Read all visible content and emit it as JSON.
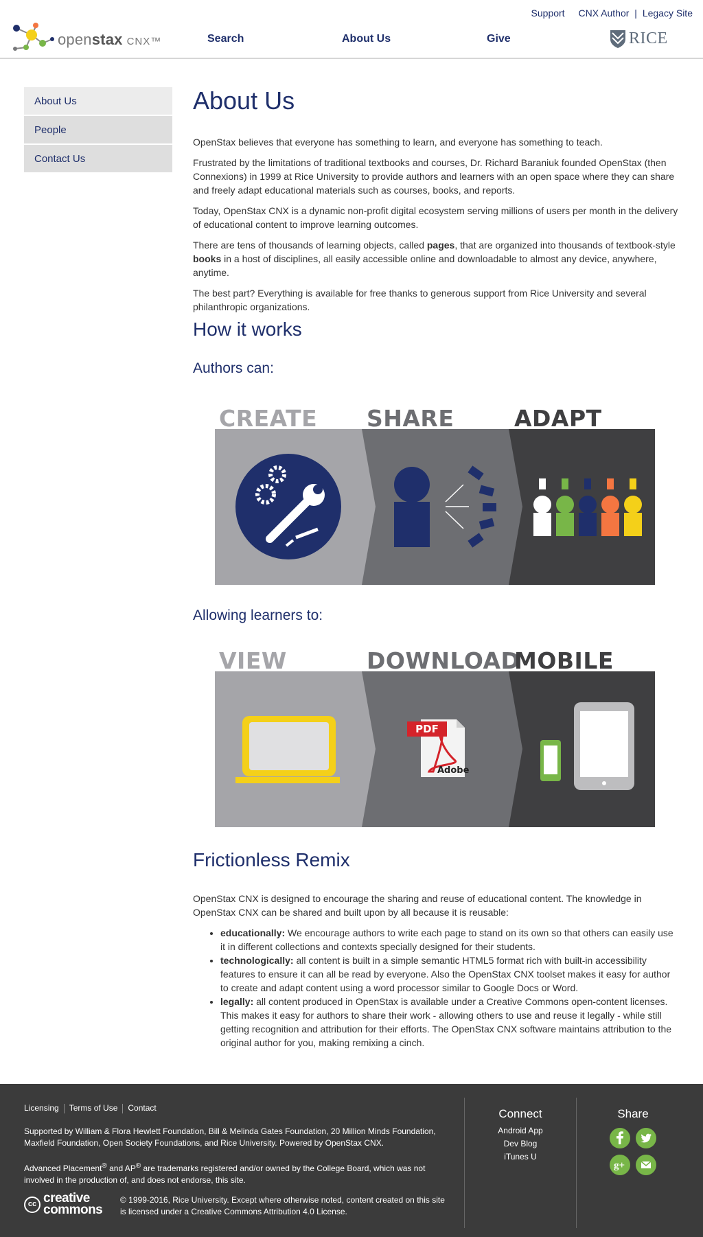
{
  "header": {
    "top_links": {
      "support": "Support",
      "cnx_author": "CNX Author",
      "separator": "|",
      "legacy_site": "Legacy Site"
    },
    "logo": {
      "word_light": "open",
      "word_bold": "stax",
      "suffix": "CNX™"
    },
    "nav": {
      "search": "Search",
      "about": "About Us",
      "give": "Give"
    },
    "rice_logo_text": "RICE"
  },
  "sidebar": {
    "items": [
      {
        "label": "About Us"
      },
      {
        "label": "People"
      },
      {
        "label": "Contact Us"
      }
    ]
  },
  "main": {
    "title": "About Us",
    "p1": "OpenStax believes that everyone has something to learn, and everyone has something to teach.",
    "p2": "Frustrated by the limitations of traditional textbooks and courses, Dr. Richard Baraniuk founded OpenStax (then Connexions) in 1999 at Rice University to provide authors and learners with an open space where they can share and freely adapt educational materials such as courses, books, and reports.",
    "p3": "Today, OpenStax CNX is a dynamic non-profit digital ecosystem serving millions of users per month in the delivery of educational content to improve learning outcomes.",
    "p4": {
      "a": "There are tens of thousands of learning objects, called ",
      "b": "pages",
      "c": ", that are organized into thousands of textbook-style ",
      "d": "books",
      "e": " in a host of disciplines, all easily accessible online and downloadable to almost any device, anywhere, anytime."
    },
    "p5": "The best part? Everything is available for free thanks to generous support from Rice University and several philanthropic organizations.",
    "how_title": "How it works",
    "authors_title": "Authors can:",
    "authors_graphic": {
      "create": "CREATE",
      "share": "SHARE",
      "adapt": "ADAPT"
    },
    "learners_title": "Allowing learners to:",
    "learners_graphic": {
      "view": "VIEW",
      "download": "DOWNLOAD",
      "mobile": "MOBILE",
      "pdf": "PDF",
      "adobe": "Adobe"
    },
    "remix_title": "Frictionless Remix",
    "remix_intro": "OpenStax CNX is designed to encourage the sharing and reuse of educational content. The knowledge in OpenStax CNX can be shared and built upon by all because it is reusable:",
    "remix_items": [
      {
        "term": "educationally:",
        "text": " We encourage authors to write each page to stand on its own so that others can easily use it in different collections and contexts specially designed for their students."
      },
      {
        "term": "technologically:",
        "text": " all content is built in a simple semantic HTML5 format rich with built-in accessibility features to ensure it can all be read by everyone. Also the OpenStax CNX toolset makes it easy for author to create and adapt content using a word processor similar to Google Docs or Word."
      },
      {
        "term": "legally:",
        "text": " all content produced in OpenStax is available under a Creative Commons open-content licenses. This makes it easy for authors to share their work - allowing others to use and reuse it legally - while still getting recognition and attribution for their efforts. The OpenStax CNX software maintains attribution to the original author for you, making remixing a cinch."
      }
    ]
  },
  "footer": {
    "links": {
      "licensing": "Licensing",
      "terms": "Terms of Use",
      "contact": "Contact"
    },
    "supported": "Supported by William & Flora Hewlett Foundation, Bill & Melinda Gates Foundation, 20 Million Minds Foundation, Maxfield Foundation, Open Society Foundations, and Rice University. Powered by OpenStax CNX.",
    "ap": {
      "a": "Advanced Placement",
      "sup1": "®",
      "b": " and AP",
      "sup2": "®",
      "c": " are trademarks registered and/or owned by the College Board, which was not involved in the production of, and does not endorse, this site."
    },
    "cc_logo": {
      "cc": "cc",
      "line1": "creative",
      "line2": "commons"
    },
    "copyright": "© 1999-2016, Rice University. Except where otherwise noted, content created on this site is licensed under a Creative Commons Attribution 4.0 License.",
    "connect": {
      "title": "Connect",
      "android": "Android App",
      "dev_blog": "Dev Blog",
      "itunes": "iTunes U"
    },
    "share": {
      "title": "Share"
    },
    "colors": {
      "share_green": "#78b648",
      "footer_bg": "#3b3b3b"
    }
  },
  "colors": {
    "brand_navy": "#1f2f6b",
    "panel_light": "#a5a5a9",
    "panel_mid": "#6d6e72",
    "panel_dark": "#3f3f41"
  }
}
